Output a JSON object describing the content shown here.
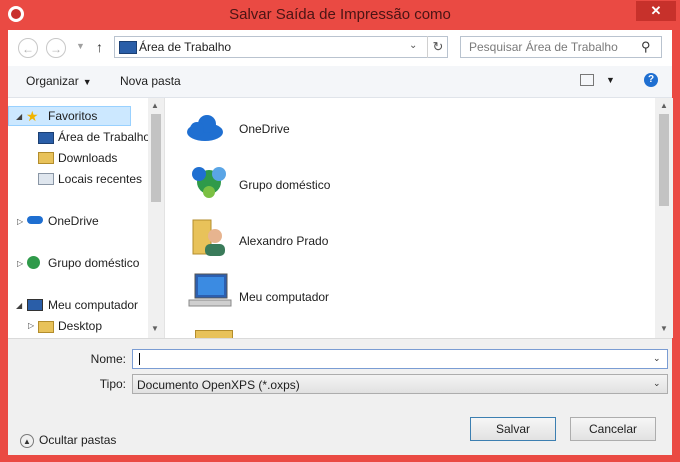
{
  "window": {
    "title": "Salvar Saída de Impressão como",
    "close_glyph": "✕",
    "accent_color": "#ea4a43"
  },
  "nav": {
    "back_glyph": "←",
    "forward_glyph": "→",
    "up_glyph": "↑",
    "address": "Área de Trabalho",
    "refresh_glyph": "↻",
    "search_placeholder": "Pesquisar Área de Trabalho",
    "search_glyph": "⚲"
  },
  "toolbar": {
    "organize": "Organizar",
    "new_folder": "Nova pasta",
    "help_glyph": "?"
  },
  "tree": {
    "favorites": "Favoritos",
    "desktop": "Área de Trabalho",
    "downloads": "Downloads",
    "recent": "Locais recentes",
    "onedrive": "OneDrive",
    "homegroup": "Grupo doméstico",
    "computer": "Meu computador",
    "desktop2": "Desktop"
  },
  "content": {
    "items": [
      {
        "label": "OneDrive",
        "icon": "onedrive-icon"
      },
      {
        "label": "Grupo doméstico",
        "icon": "homegroup-icon"
      },
      {
        "label": "Alexandro Prado",
        "icon": "user-folder-icon"
      },
      {
        "label": "Meu computador",
        "icon": "computer-icon"
      }
    ]
  },
  "form": {
    "name_label": "Nome:",
    "name_value": "",
    "type_label": "Tipo:",
    "type_value": "Documento OpenXPS (*.oxps)",
    "hide_folders": "Ocultar pastas",
    "save": "Salvar",
    "cancel": "Cancelar"
  }
}
